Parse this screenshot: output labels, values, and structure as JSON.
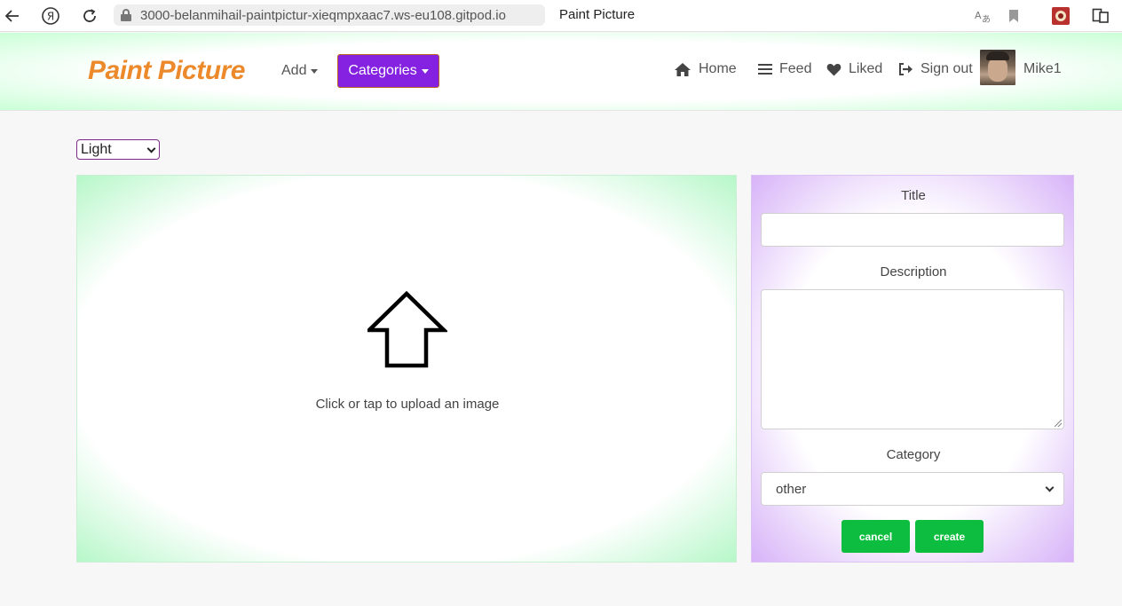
{
  "browser": {
    "url": "3000-belanmihail-paintpictur-xieqmpxaac7.ws-eu108.gitpod.io",
    "tab_title": "Paint Picture",
    "yandex_glyph": "Я"
  },
  "navbar": {
    "brand": "Paint Picture",
    "add_label": "Add",
    "categories_label": "Categories",
    "links": {
      "home": "Home",
      "feed": "Feed",
      "liked": "Liked",
      "signout": "Sign out"
    },
    "username": "Mike1"
  },
  "theme_select": {
    "value": "Light"
  },
  "upload": {
    "text": "Click or tap to upload an image"
  },
  "form": {
    "title_label": "Title",
    "title_value": "",
    "description_label": "Description",
    "description_value": "",
    "category_label": "Category",
    "category_value": "other",
    "cancel_label": "cancel",
    "create_label": "create"
  },
  "colors": {
    "brand": "#ec8a2b",
    "categories_button": "#8521e0",
    "action_button": "#0dbd3f"
  }
}
